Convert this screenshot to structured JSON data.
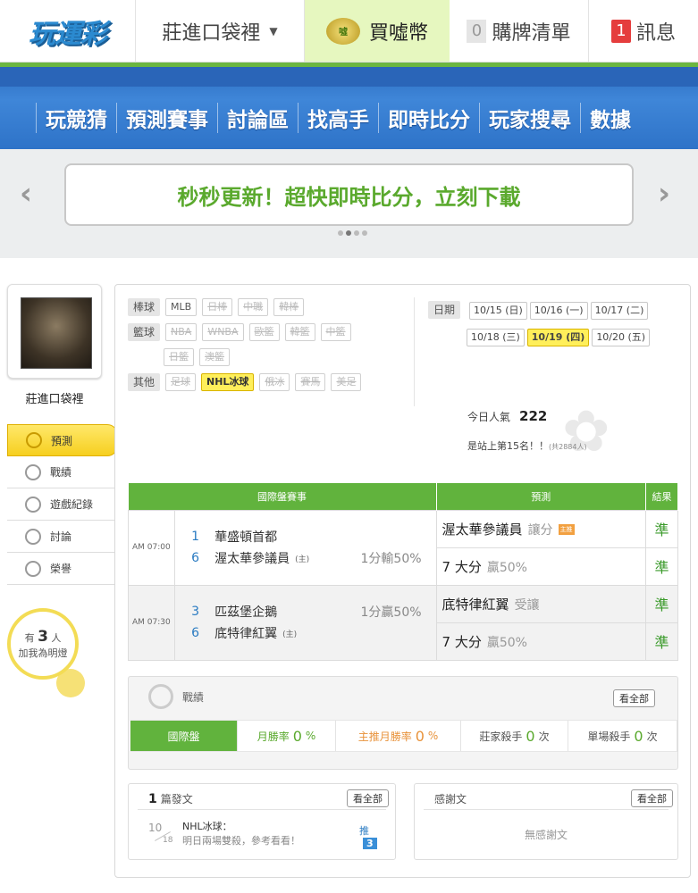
{
  "header": {
    "logo": "玩運彩",
    "username": "莊進口袋裡",
    "coin_label": "買噓幣",
    "coin_icon_text": "噓",
    "cart_count": "0",
    "cart_label": "購牌清單",
    "msg_count": "1",
    "msg_label": "訊息"
  },
  "nav": {
    "items": [
      "玩競猜",
      "預測賽事",
      "討論區",
      "找高手",
      "即時比分",
      "玩家搜尋",
      "數據"
    ]
  },
  "banner": {
    "text": "秒秒更新！超快即時比分，立刻下載",
    "prev": "‹",
    "next": "›"
  },
  "profile": {
    "name": "莊進口袋裡"
  },
  "sidemenu": {
    "items": [
      "預測",
      "戰績",
      "遊戲紀錄",
      "討論",
      "榮譽"
    ]
  },
  "fans": {
    "prefix": "有",
    "count": "3",
    "suffix": "人",
    "line2": "加我為明燈"
  },
  "filters": {
    "baseball_label": "棒球",
    "baseball": [
      "MLB",
      "日棒",
      "中職",
      "韓棒"
    ],
    "basketball_label": "籃球",
    "basketball": [
      "NBA",
      "WNBA",
      "歐籃",
      "韓籃",
      "中籃",
      "日籃",
      "澳籃"
    ],
    "other_label": "其他",
    "other": [
      "足球",
      "NHL冰球",
      "俄冰",
      "賽馬",
      "美足"
    ],
    "date_label": "日期",
    "dates": [
      "10/15 (日)",
      "10/16 (一)",
      "10/17 (二)",
      "10/18 (三)",
      "10/19 (四)",
      "10/20 (五)"
    ]
  },
  "popularity": {
    "label": "今日人氣",
    "value": "222",
    "rank_text": "是站上第15名！！",
    "rank_small": "(共2884人)"
  },
  "table": {
    "headers": [
      "國際盤賽事",
      "預測",
      "結果"
    ],
    "games": [
      {
        "time": "AM 07:00",
        "away_num": "1",
        "away": "華盛頓首都",
        "home_num": "6",
        "home": "渥太華參議員",
        "home_tag": "(主)",
        "line": "1分輸50%",
        "pick1": "渥太華參議員",
        "pick1_sub": "讓分",
        "pick1_tag": "主推",
        "res1": "準",
        "pick2": "7 大分",
        "pick2_sub": "贏50%",
        "res2": "準"
      },
      {
        "time": "AM 07:30",
        "away_num": "3",
        "away": "匹茲堡企鵝",
        "home_num": "6",
        "home": "底特律紅翼",
        "home_tag": "(主)",
        "line": "1分贏50%",
        "pick1": "底特律紅翼",
        "pick1_sub": "受讓",
        "res1": "準",
        "pick2": "7 大分",
        "pick2_sub": "贏50%",
        "res2": "準"
      }
    ]
  },
  "record": {
    "title": "戰績",
    "view_all": "看全部",
    "tab": "國際盤",
    "month_label": "月勝率",
    "month_val": "0",
    "month_unit": "%",
    "main_label": "主推月勝率",
    "main_val": "0",
    "main_unit": "%",
    "killer_label": "莊家殺手",
    "killer_val": "0",
    "killer_unit": "次",
    "single_label": "單場殺手",
    "single_val": "0",
    "single_unit": "次"
  },
  "posts": {
    "count": "1",
    "label": "篇發文",
    "view_all": "看全部",
    "item": {
      "month": "10",
      "day": "18",
      "title": "NHL冰球：",
      "content": "明日兩場雙殺，參考看看！",
      "push_label": "推",
      "push_count": "3"
    }
  },
  "thanks": {
    "label": "感謝文",
    "view_all": "看全部",
    "empty": "無感謝文"
  }
}
